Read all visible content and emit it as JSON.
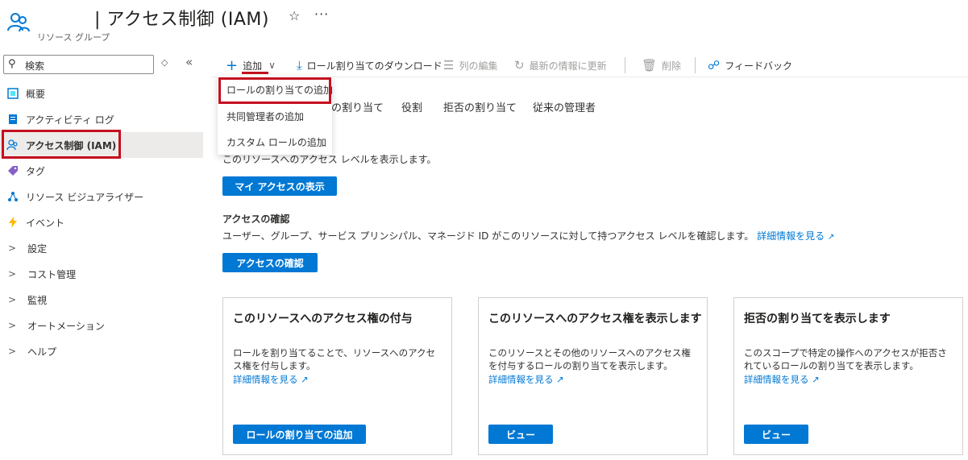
{
  "header": {
    "title": "| アクセス制御 (IAM)",
    "subtitle": "リソース グループ",
    "favorite_glyph": "☆",
    "more_glyph": "···",
    "icon": "users-icon"
  },
  "sidebar": {
    "search_placeholder": "検索",
    "items": [
      {
        "label": "概要",
        "icon": "overview-icon"
      },
      {
        "label": "アクティビティ ログ",
        "icon": "activity-log-icon"
      },
      {
        "label": "アクセス制御 (IAM)",
        "icon": "users-icon"
      },
      {
        "label": "タグ",
        "icon": "tag-icon"
      },
      {
        "label": "リソース ビジュアライザー",
        "icon": "visualizer-icon"
      },
      {
        "label": "イベント",
        "icon": "lightning-icon"
      },
      {
        "label": "設定",
        "icon": "chevron-right-icon"
      },
      {
        "label": "コスト管理",
        "icon": "chevron-right-icon"
      },
      {
        "label": "監視",
        "icon": "chevron-right-icon"
      },
      {
        "label": "オートメーション",
        "icon": "chevron-right-icon"
      },
      {
        "label": "ヘルプ",
        "icon": "chevron-right-icon"
      }
    ]
  },
  "toolbar": {
    "add": "追加",
    "download": "ロール割り当てのダウンロード",
    "edit_columns": "列の編集",
    "refresh": "最新の情報に更新",
    "delete": "削除",
    "feedback": "フィードバック"
  },
  "dropdown": {
    "items": [
      "ロールの割り当ての追加",
      "共同管理者の追加",
      "カスタム ロールの追加"
    ]
  },
  "tabs": [
    "ルの割り当て",
    "役割",
    "拒否の割り当て",
    "従来の管理者"
  ],
  "content": {
    "my_access_desc": "このリソースへのアクセス レベルを表示します。",
    "my_access_button": "マイ アクセスの表示",
    "check_access_title": "アクセスの確認",
    "check_access_desc": "ユーザー、グループ、サービス プリンシパル、マネージド ID がこのリソースに対して持つアクセス レベルを確認します。",
    "learn_more": "詳細情報を見る",
    "check_access_button": "アクセスの確認"
  },
  "cards": [
    {
      "title": "このリソースへのアクセス権の付与",
      "desc": "ロールを割り当てることで、リソースへのアクセス権を付与します。",
      "link": "詳細情報を見る",
      "button": "ロールの割り当ての追加"
    },
    {
      "title": "このリソースへのアクセス権を表示します",
      "desc": "このリソースとその他のリソースへのアクセス権を付与するロールの割り当てを表示します。",
      "link": "詳細情報を見る",
      "button": "ビュー"
    },
    {
      "title": "拒否の割り当てを表示します",
      "desc": "このスコープで特定の操作へのアクセスが拒否されているロールの割り当てを表示します。",
      "link": "詳細情報を見る",
      "button": "ビュー"
    }
  ],
  "colors": {
    "accent": "#0078d4",
    "highlight": "#c50f1f",
    "active_bg": "#edebe9"
  }
}
